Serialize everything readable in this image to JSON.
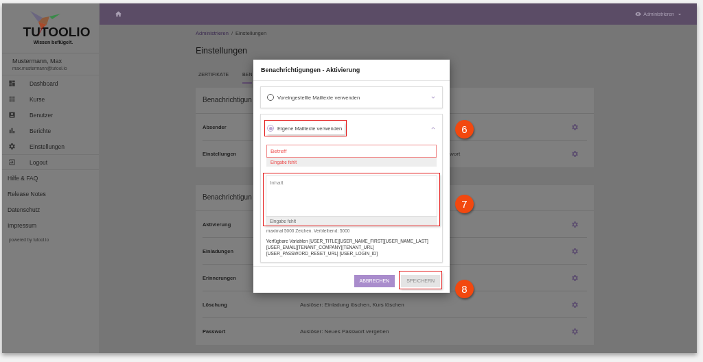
{
  "header": {
    "user_menu": "Administrieren"
  },
  "sidebar": {
    "logo": {
      "name": "TUTOOLIO",
      "tagline": "Wissen beflügelt."
    },
    "user": {
      "name": "Mustermann, Max",
      "email": "max.mustermann@tutool.io"
    },
    "menu": [
      {
        "label": "Dashboard"
      },
      {
        "label": "Kurse"
      },
      {
        "label": "Benutzer"
      },
      {
        "label": "Berichte"
      },
      {
        "label": "Einstellungen"
      }
    ],
    "logout": "Logout",
    "links": [
      "Hilfe & FAQ",
      "Release Notes",
      "Datenschutz",
      "Impressum"
    ],
    "footer": "powered by tutool.io"
  },
  "breadcrumb_separator": "/",
  "breadcrumb": [
    {
      "label": "Administrieren",
      "link": true
    },
    {
      "label": "Einstellungen",
      "link": false
    }
  ],
  "title": "Einstellungen",
  "tabs": [
    {
      "label": "ZERTIFIKATE",
      "selected": false
    },
    {
      "label": "BEN",
      "selected": true
    }
  ],
  "cards": [
    {
      "title": "Benachrichtigun",
      "rows": [
        {
          "label": "Absender"
        },
        {
          "label": "Einstellungen",
          "value": "wort",
          "kind": "cut"
        }
      ]
    },
    {
      "title": "Benachrichtigun",
      "rows": [
        {
          "label": "Aktivierung"
        },
        {
          "label": "Einladungen"
        },
        {
          "label": "Erinnerungen"
        },
        {
          "label": "Löschung",
          "value": "Auslöser: Einladung löschen, Kurs löschen",
          "kind": "plain"
        },
        {
          "label": "Passwort",
          "value": "Auslöser: Neues Passwort vergeben",
          "kind": "plain"
        }
      ]
    }
  ],
  "modal": {
    "title": "Benachrichtigungen - Aktivierung",
    "options": [
      {
        "label": "Voreingestellte Mailtexte verwenden",
        "selected": false,
        "expanded": false,
        "highlight": false
      },
      {
        "label": "Eigene Mailtexte verwenden",
        "selected": true,
        "expanded": true,
        "highlight": true,
        "callout": "6"
      }
    ],
    "subject": {
      "placeholder": "Betreff",
      "error": "Eingabe fehlt",
      "invalid": true
    },
    "body": {
      "placeholder": "Inhalt",
      "error": "Eingabe fehlt",
      "highlight": true,
      "callout": "7"
    },
    "counter": "maximal 5000 Zeichen. Verbleibend: 5000",
    "variables": "Verfügbare Variablen [USER_TITLE][USER_NAME_FIRST][USER_NAME_LAST] [USER_EMAIL][TENANT_COMPANY][TENANT_URL][USER_PASSWORD_RESET_URL] [USER_LOGIN_ID]",
    "buttons": [
      {
        "label": "ABBRECHEN",
        "disabled": false
      },
      {
        "label": "SPEICHERN",
        "disabled": true,
        "highlight": true,
        "callout": "8"
      }
    ]
  }
}
